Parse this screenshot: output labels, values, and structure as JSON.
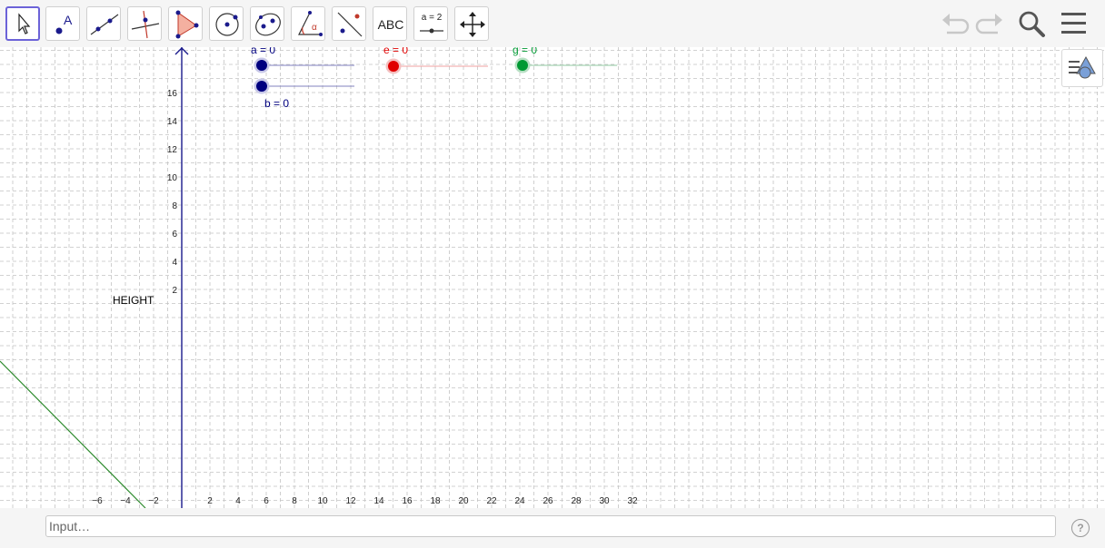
{
  "toolbar": {
    "tools": [
      {
        "name": "move-tool",
        "selected": true
      },
      {
        "name": "point-tool",
        "glyph": "A"
      },
      {
        "name": "line-tool"
      },
      {
        "name": "perpendicular-line-tool"
      },
      {
        "name": "polygon-tool"
      },
      {
        "name": "circle-center-point-tool"
      },
      {
        "name": "conic-tool"
      },
      {
        "name": "angle-tool",
        "glyph": "α"
      },
      {
        "name": "reflect-tool"
      },
      {
        "name": "text-tool",
        "label": "ABC"
      },
      {
        "name": "slider-tool",
        "label": "a = 2"
      },
      {
        "name": "move-graphics-view-tool"
      }
    ],
    "right_icons": [
      "undo-icon",
      "redo-icon",
      "search-icon",
      "menu-icon"
    ]
  },
  "graphics": {
    "x_ticks": [
      "−6",
      "−4",
      "−2",
      "2",
      "4",
      "6",
      "8",
      "10",
      "12",
      "14",
      "16",
      "18",
      "20",
      "22",
      "24",
      "26",
      "28",
      "30",
      "32"
    ],
    "y_ticks": [
      "2",
      "4",
      "6",
      "8",
      "10",
      "12",
      "14",
      "16"
    ],
    "text_label": "HEIGHT",
    "sliders": [
      {
        "label": "a = 0",
        "color": "#00007f",
        "value": 0
      },
      {
        "label": "b = 0",
        "color": "#00007f",
        "value": 0
      },
      {
        "label": "e = 0",
        "color": "#e00000",
        "value": 0
      },
      {
        "label": "g = 0",
        "color": "#009933",
        "value": 0
      }
    ],
    "line_color": "#2e8b2e",
    "axis_color": "#1a1a8c"
  },
  "input": {
    "placeholder": "Input…"
  },
  "help_glyph": "?"
}
